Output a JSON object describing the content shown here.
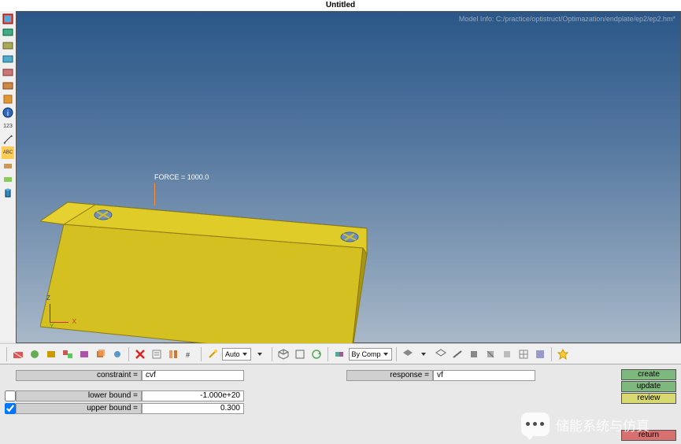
{
  "title": "Untitled",
  "model_info": "Model Info: C:/practice/optistruct/Optimazation/endplate/ep2/ep2.hm*",
  "annotation": {
    "force_label": "FORCE = 1000.0"
  },
  "axes": {
    "x": "X",
    "y": "Y",
    "z": "Z"
  },
  "bottom_toolbar": {
    "auto_label": "Auto",
    "bycomp_label": "By Comp"
  },
  "panel": {
    "left_fields": {
      "constraint": {
        "label": "constraint =",
        "value": "cvf"
      },
      "lower_bound": {
        "label": "lower bound =",
        "value": "-1.000e+20",
        "checked": false
      },
      "upper_bound": {
        "label": "upper bound =",
        "value": "0.300",
        "checked": true
      }
    },
    "right_fields": {
      "response": {
        "label": "response =",
        "value": "vf"
      }
    },
    "buttons": {
      "create": "create",
      "update": "update",
      "review": "review",
      "return": "return"
    }
  },
  "overlay": {
    "wechat_text": "储能系统与仿真"
  }
}
